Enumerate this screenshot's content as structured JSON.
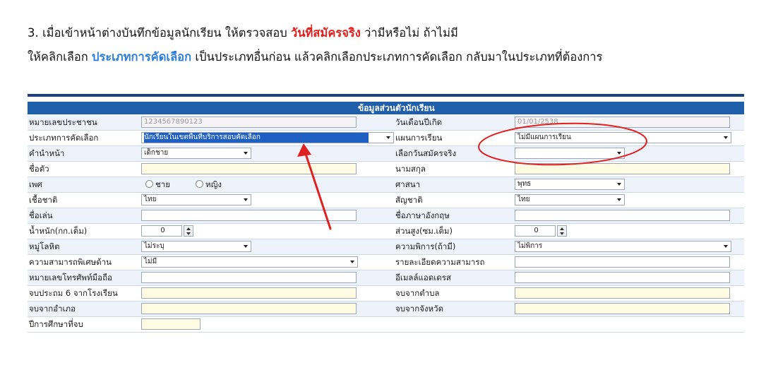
{
  "instructions": {
    "line1_prefix": "3. เมื่อเข้าหน้าต่างบันทึกข้อมูลนักเรียน ให้ตรวจสอบ ",
    "line1_highlight": "วันที่สมัครจริง",
    "line1_suffix": " ว่ามีหรือไม่ ถ้าไม่มี",
    "line2_prefix": "ให้คลิกเลือก ",
    "line2_highlight": "ประเภทการคัดเลือก",
    "line2_suffix": " เป็นประเภทอื่นก่อน แล้วคลิกเลือกประเภทการคัดเลือก กลับมาในประเภทที่ต้องการ"
  },
  "form": {
    "header": "ข้อมูลส่วนตัวนักเรียน",
    "rows": [
      {
        "left": {
          "label": "หมายเลขประชาชน",
          "value": "1234567890123"
        },
        "right": {
          "label": "วันเดือนปีเกิด",
          "value": "01/01/2538"
        }
      },
      {
        "left": {
          "label": "ประเภทการคัดเลือก",
          "value": "นักเรียนในเขตพื้นที่บริการสอบคัดเลือก"
        },
        "right": {
          "label": "แผนการเรียน",
          "value": "ไม่มีแผนการเรียน"
        }
      },
      {
        "left": {
          "label": "คำนำหน้า",
          "value": "เด็กชาย"
        },
        "right": {
          "label": "เลือกวันสมัครจริง",
          "value": ""
        }
      },
      {
        "left": {
          "label": "ชื่อตัว",
          "value": ""
        },
        "right": {
          "label": "นามสกุล",
          "value": ""
        }
      },
      {
        "left": {
          "label": "เพศ",
          "options": [
            "ชาย",
            "หญิง"
          ]
        },
        "right": {
          "label": "ศาสนา",
          "value": "พุทธ"
        }
      },
      {
        "left": {
          "label": "เชื้อชาติ",
          "value": "ไทย"
        },
        "right": {
          "label": "สัญชาติ",
          "value": "ไทย"
        }
      },
      {
        "left": {
          "label": "ชื่อเล่น",
          "value": ""
        },
        "right": {
          "label": "ชื่อภาษาอังกฤษ",
          "value": ""
        }
      },
      {
        "left": {
          "label": "น้ำหนัก(กก.เต็ม)",
          "value": "0"
        },
        "right": {
          "label": "ส่วนสูง(ซม.เต็ม)",
          "value": "0"
        }
      },
      {
        "left": {
          "label": "หมู่โลหิต",
          "value": "ไม่ระบุ"
        },
        "right": {
          "label": "ความพิการ(ถ้ามี)",
          "value": "ไม่พิการ"
        }
      },
      {
        "left": {
          "label": "ความสามารถพิเศษด้าน",
          "value": "ไม่มี"
        },
        "right": {
          "label": "รายละเอียดความสามารถ",
          "value": ""
        }
      },
      {
        "left": {
          "label": "หมายเลขโทรศัพท์มือถือ",
          "value": ""
        },
        "right": {
          "label": "อีเมลล์แอดเดรส",
          "value": ""
        }
      },
      {
        "left": {
          "label": "จบประถม 6 จากโรงเรียน",
          "value": ""
        },
        "right": {
          "label": "จบจากตำบล",
          "value": ""
        }
      },
      {
        "left": {
          "label": "จบจากอำเภอ",
          "value": ""
        },
        "right": {
          "label": "จบจากจังหวัด",
          "value": ""
        }
      },
      {
        "left": {
          "label": "ปีการศึกษาที่จบ",
          "value": ""
        }
      }
    ]
  },
  "colors": {
    "header_bg": "#1f5ea8",
    "highlight_red": "#e0201f",
    "highlight_blue": "#2f7fd9",
    "annotation_red": "#e02020"
  }
}
